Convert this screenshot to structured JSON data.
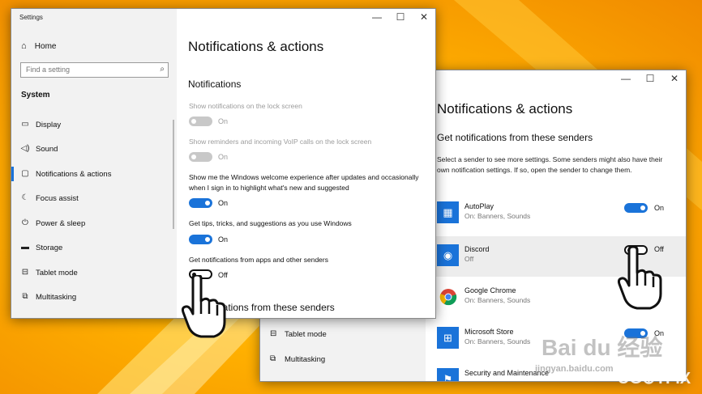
{
  "front": {
    "window_title": "Settings",
    "controls": {
      "minimize": "—",
      "maximize": "☐",
      "close": "✕"
    },
    "sidebar": {
      "home_label": "Home",
      "search_placeholder": "Find a setting",
      "section_header": "System",
      "items": [
        {
          "label": "Display",
          "icon": "display-icon"
        },
        {
          "label": "Sound",
          "icon": "sound-icon"
        },
        {
          "label": "Notifications & actions",
          "icon": "notifications-icon"
        },
        {
          "label": "Focus assist",
          "icon": "focus-assist-icon"
        },
        {
          "label": "Power & sleep",
          "icon": "power-icon"
        },
        {
          "label": "Storage",
          "icon": "storage-icon"
        },
        {
          "label": "Tablet mode",
          "icon": "tablet-mode-icon"
        },
        {
          "label": "Multitasking",
          "icon": "multitasking-icon"
        }
      ]
    },
    "main": {
      "title": "Notifications & actions",
      "section": "Notifications",
      "settings": [
        {
          "text": "Show notifications on the lock screen",
          "state": "On",
          "enabled": false
        },
        {
          "text": "Show reminders and incoming VoIP calls on the lock screen",
          "state": "On",
          "enabled": false
        },
        {
          "text": "Show me the Windows welcome experience after updates and occasionally when I sign in to highlight what's new and suggested",
          "state": "On",
          "enabled": true
        },
        {
          "text": "Get tips, tricks, and suggestions as you use Windows",
          "state": "On",
          "enabled": true
        },
        {
          "text": "Get notifications from apps and other senders",
          "state": "Off",
          "enabled": true
        }
      ],
      "next_section_partial": "ications from these senders"
    }
  },
  "back": {
    "sidebar_items": [
      {
        "label": "Tablet mode"
      },
      {
        "label": "Multitasking"
      }
    ],
    "main": {
      "title": "Notifications & actions",
      "section": "Get notifications from these senders",
      "description": "Select a sender to see more settings. Some senders might also have their own notification settings. If so, open the sender to change them.",
      "senders": [
        {
          "name": "AutoPlay",
          "sub": "On: Banners, Sounds",
          "state": "On",
          "color": "#1a73d9"
        },
        {
          "name": "Discord",
          "sub": "Off",
          "state": "Off",
          "color": "#7289da"
        },
        {
          "name": "Google Chrome",
          "sub": "On: Banners, Sounds",
          "state": "",
          "color": "#ffffff"
        },
        {
          "name": "Microsoft Store",
          "sub": "On: Banners, Sounds",
          "state": "On",
          "color": "#1a73d9"
        },
        {
          "name": "Security and Maintenance",
          "sub": "",
          "state": "",
          "color": "#1a73d9"
        }
      ]
    }
  },
  "watermarks": {
    "baidu": "Bai du 经验",
    "url": "jingyan.baidu.com",
    "brand": "UG⊕TFIX"
  },
  "colors": {
    "accent": "#1a73d9",
    "background": "#ffb000"
  }
}
